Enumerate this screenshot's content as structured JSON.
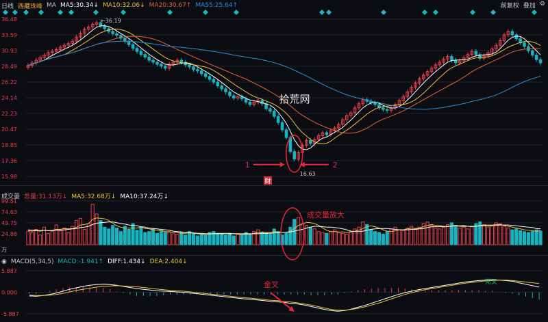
{
  "header": {
    "period": "日线",
    "stock_name": "西藏珠峰",
    "ma_label": "MA",
    "ma5": "MA5:30.34↓",
    "ma10": "MA10:32.06↓",
    "ma20": "MA20:30.67↑",
    "ma55": "MA55:25.64↑",
    "right_restore": "前复权",
    "right_overlay": "叠加",
    "colors": {
      "ma5": "#ffffff",
      "ma10": "#f0c23b",
      "ma20": "#e8623a",
      "ma55": "#2b8fd8",
      "up": "#e8414b",
      "down": "#19b3c0"
    }
  },
  "volume_header": {
    "title": "成交量",
    "total": "总量:31.13万↓",
    "ma5": "MA5:32.68万↓",
    "ma10": "MA10:37.24万↓"
  },
  "macd_header": {
    "title": "MACD(5,34,5)",
    "macd": "MACD:-1.941↑",
    "diff": "DIFF:1.434↓",
    "dea": "DEA:2.404↓"
  },
  "annotations": {
    "high_label": "36.19",
    "low_label": "16.63",
    "arrow1": "1",
    "arrow2": "2",
    "volume_note": "成交量放大",
    "golden_cross": "金叉",
    "dead_cross": "死叉",
    "watermark": "拾荒网",
    "cai": "财",
    "unit": "万"
  },
  "chart_data": [
    {
      "type": "candlestick",
      "title": "",
      "y_ticks": [
        "36.48",
        "33.59",
        "30.93",
        "28.49",
        "26.22",
        "24.14",
        "22.23",
        "20.47",
        "18.85",
        "17.36",
        "15.98"
      ],
      "ylim": [
        15.98,
        36.48
      ],
      "scale": "log",
      "close": [
        28.6,
        29.0,
        29.4,
        29.8,
        30.2,
        30.6,
        30.8,
        31.1,
        31.5,
        31.8,
        32.1,
        32.5,
        33.2,
        33.9,
        34.6,
        35.0,
        35.5,
        35.8,
        35.2,
        34.7,
        34.2,
        33.8,
        33.5,
        33.0,
        32.5,
        31.9,
        31.3,
        30.8,
        30.3,
        29.9,
        29.4,
        29.1,
        28.8,
        28.5,
        28.2,
        28.8,
        29.1,
        29.4,
        29.1,
        28.7,
        28.4,
        28.0,
        27.8,
        27.4,
        27.0,
        26.6,
        26.2,
        25.7,
        25.3,
        24.9,
        24.4,
        24.1,
        24.3,
        24.0,
        23.6,
        23.3,
        23.6,
        23.8,
        23.4,
        22.8,
        22.5,
        21.9,
        21.2,
        20.4,
        19.6,
        18.2,
        17.5,
        18.1,
        18.8,
        19.3,
        19.0,
        19.4,
        19.8,
        20.1,
        19.9,
        20.3,
        20.6,
        21.0,
        21.5,
        22.0,
        22.3,
        22.9,
        23.4,
        23.9,
        23.7,
        23.5,
        23.3,
        22.9,
        22.7,
        22.6,
        22.9,
        23.3,
        23.8,
        24.3,
        24.9,
        25.5,
        26.1,
        26.7,
        27.2,
        27.7,
        28.2,
        28.7,
        29.1,
        29.6,
        30.0,
        29.4,
        29.0,
        29.3,
        29.8,
        30.3,
        30.8,
        30.3,
        29.7,
        30.1,
        30.6,
        31.2,
        31.8,
        32.6,
        33.6,
        34.2,
        33.6,
        32.9,
        32.2,
        31.6,
        30.9,
        30.2,
        29.5,
        29.0
      ],
      "annotated_high": 36.19,
      "annotated_low": 16.63
    },
    {
      "type": "bar",
      "title": "",
      "y_ticks": [
        "99.51",
        "74.63",
        "49.75",
        "24.88"
      ],
      "ylim": [
        0,
        99.51
      ],
      "unit": "万",
      "values": [
        30,
        28,
        35,
        22,
        40,
        26,
        30,
        45,
        32,
        38,
        28,
        42,
        55,
        60,
        35,
        48,
        92,
        70,
        55,
        40,
        36,
        44,
        38,
        30,
        42,
        35,
        48,
        33,
        40,
        28,
        30,
        36,
        26,
        32,
        28,
        30,
        25,
        24,
        28,
        22,
        30,
        26,
        20,
        24,
        22,
        28,
        30,
        26,
        24,
        22,
        26,
        20,
        24,
        22,
        28,
        24,
        30,
        34,
        28,
        26,
        24,
        36,
        30,
        22,
        26,
        40,
        58,
        62,
        48,
        44,
        40,
        36,
        30,
        28,
        26,
        30,
        34,
        28,
        26,
        24,
        30,
        36,
        40,
        52,
        46,
        34,
        30,
        28,
        24,
        30,
        36,
        40,
        34,
        32,
        38,
        42,
        36,
        40,
        48,
        52,
        44,
        38,
        36,
        40,
        46,
        50,
        44,
        38,
        40,
        36,
        42,
        48,
        52,
        46,
        40,
        44,
        50,
        48,
        42,
        38,
        34,
        36,
        32,
        30,
        28,
        30,
        34,
        31
      ],
      "ma5": [
        32,
        31,
        32,
        31,
        33,
        32,
        33,
        35,
        35,
        37,
        36,
        37,
        40,
        45,
        46,
        48,
        58,
        61,
        60,
        59,
        55,
        49,
        43,
        40,
        38,
        38,
        38,
        38,
        40,
        37,
        36,
        34,
        33,
        32,
        30,
        29,
        28,
        28,
        26,
        26,
        27,
        26,
        25,
        24,
        24,
        24,
        25,
        26,
        26,
        26,
        26,
        25,
        24,
        23,
        24,
        24,
        26,
        28,
        29,
        28,
        28,
        30,
        29,
        28,
        28,
        31,
        37,
        44,
        47,
        51,
        50,
        48,
        44,
        38,
        33,
        30,
        30,
        29,
        29,
        28,
        29,
        31,
        33,
        37,
        41,
        43,
        41,
        38,
        34,
        31,
        30,
        32,
        34,
        34,
        36,
        38,
        37,
        38,
        41,
        44,
        46,
        44,
        44,
        42,
        41,
        43,
        44,
        43,
        44,
        42,
        41,
        42,
        44,
        45,
        45,
        45,
        46,
        46,
        44,
        42,
        40,
        38,
        36,
        34,
        33,
        32,
        31,
        32
      ],
      "ma10": [
        34,
        33,
        33,
        32,
        33,
        32,
        32,
        33,
        33,
        34,
        35,
        36,
        37,
        39,
        40,
        42,
        46,
        49,
        50,
        51,
        52,
        52,
        50,
        48,
        47,
        45,
        44,
        43,
        41,
        40,
        38,
        37,
        36,
        35,
        34,
        33,
        31,
        30,
        29,
        28,
        28,
        27,
        26,
        26,
        25,
        25,
        25,
        25,
        25,
        25,
        25,
        25,
        25,
        25,
        25,
        25,
        25,
        25,
        26,
        26,
        26,
        27,
        28,
        28,
        28,
        29,
        31,
        33,
        35,
        38,
        40,
        42,
        42,
        41,
        40,
        40,
        39,
        38,
        36,
        34,
        31,
        30,
        30,
        31,
        33,
        35,
        36,
        37,
        37,
        37,
        36,
        35,
        34,
        34,
        34,
        35,
        35,
        36,
        37,
        39,
        41,
        41,
        41,
        41,
        42,
        42,
        43,
        42,
        42,
        42,
        42,
        42,
        43,
        43,
        43,
        43,
        44,
        45,
        45,
        45,
        44,
        43,
        42,
        41,
        40,
        39,
        37,
        36
      ]
    },
    {
      "type": "line",
      "title": "",
      "y_ticks": [
        "5.887",
        "0.000",
        "-5.887"
      ],
      "ylim": [
        -5.887,
        5.887
      ],
      "series": [
        {
          "name": "DIFF",
          "values": [
            -1.0,
            -1.1,
            -0.9,
            -0.6,
            -0.2,
            0.3,
            0.8,
            1.2,
            1.6,
            1.9,
            2.1,
            2.2,
            2.1,
            1.9,
            1.6,
            1.3,
            1.0,
            0.8,
            0.6,
            0.4,
            0.3,
            0.2,
            0.1,
            0.0,
            -0.2,
            -0.4,
            -0.6,
            -0.8,
            -1.0,
            -1.2,
            -1.4,
            -1.6,
            -1.8,
            -1.9,
            -2.1,
            -2.3,
            -2.5,
            -2.6,
            -2.8,
            -3.0,
            -3.2,
            -3.5,
            -3.9,
            -4.3,
            -4.7,
            -5.0,
            -5.2,
            -5.0,
            -4.6,
            -4.1,
            -3.6,
            -3.0,
            -2.4,
            -1.8,
            -1.2,
            -0.6,
            -0.1,
            0.3,
            0.7,
            1.0,
            1.3,
            1.6,
            1.9,
            2.2,
            2.5,
            2.8,
            3.0,
            3.2,
            3.3,
            3.4,
            3.3,
            3.2,
            3.0,
            2.6,
            2.2,
            1.8,
            1.4
          ]
        },
        {
          "name": "DEA",
          "values": [
            -0.8,
            -0.9,
            -0.9,
            -0.8,
            -0.6,
            -0.3,
            0.1,
            0.5,
            0.8,
            1.1,
            1.4,
            1.6,
            1.7,
            1.8,
            1.7,
            1.6,
            1.5,
            1.3,
            1.1,
            0.9,
            0.7,
            0.5,
            0.4,
            0.3,
            0.1,
            -0.1,
            -0.3,
            -0.5,
            -0.7,
            -0.9,
            -1.1,
            -1.3,
            -1.5,
            -1.6,
            -1.8,
            -2.0,
            -2.2,
            -2.3,
            -2.5,
            -2.7,
            -2.9,
            -3.2,
            -3.5,
            -3.9,
            -4.3,
            -4.7,
            -4.9,
            -4.9,
            -4.7,
            -4.4,
            -4.0,
            -3.5,
            -3.0,
            -2.4,
            -1.8,
            -1.2,
            -0.6,
            -0.1,
            0.3,
            0.7,
            1.0,
            1.3,
            1.6,
            1.9,
            2.2,
            2.5,
            2.7,
            2.9,
            3.1,
            3.2,
            3.3,
            3.3,
            3.2,
            3.0,
            2.8,
            2.6,
            2.4
          ]
        }
      ]
    }
  ]
}
